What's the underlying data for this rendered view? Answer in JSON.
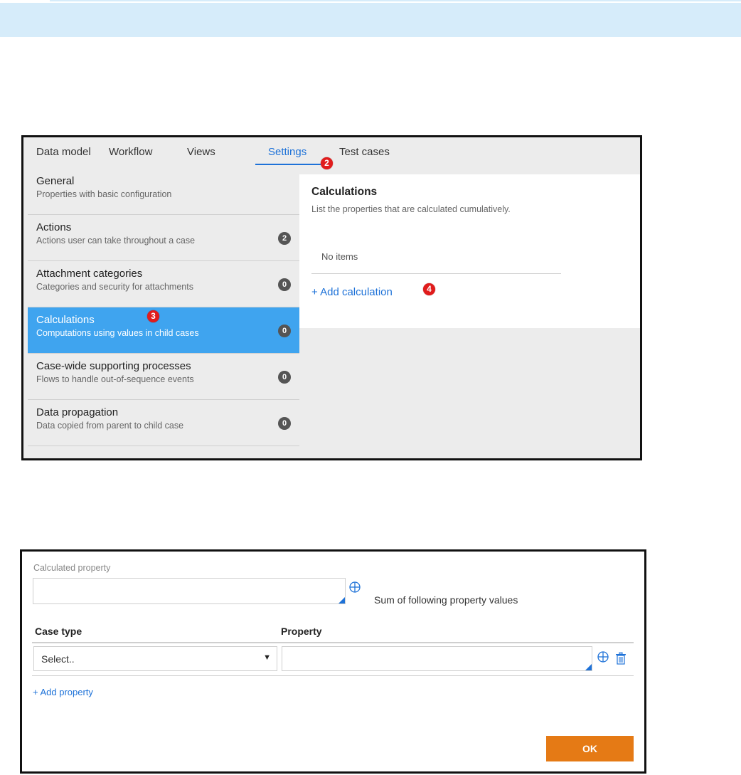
{
  "tabs": [
    {
      "label": "Data model"
    },
    {
      "label": "Workflow"
    },
    {
      "label": "Views"
    },
    {
      "label": "Settings"
    },
    {
      "label": "Test cases"
    }
  ],
  "active_tab": "Settings",
  "markers": [
    "2",
    "3",
    "4"
  ],
  "sidebar": {
    "items": [
      {
        "title": "General",
        "desc": "Properties with basic configuration"
      },
      {
        "title": "Actions",
        "desc": "Actions user can take throughout a case",
        "count": "2"
      },
      {
        "title": "Attachment categories",
        "desc": "Categories and security for attachments",
        "count": "0"
      },
      {
        "title": "Calculations",
        "desc": "Computations using values in child cases",
        "count": "0"
      },
      {
        "title": "Case-wide supporting processes",
        "desc": "Flows to handle out-of-sequence events",
        "count": "0"
      },
      {
        "title": "Data propagation",
        "desc": "Data copied from parent to child case",
        "count": "0"
      }
    ]
  },
  "content": {
    "title": "Calculations",
    "subtitle": "List the properties that are calculated cumulatively.",
    "empty_text": "No items",
    "add_link": "+ Add calculation"
  },
  "dialog": {
    "calculated_property_label": "Calculated property",
    "calculated_property_value": "",
    "sum_text": "Sum of following property values",
    "columns": [
      "Case type",
      "Property"
    ],
    "case_type_value": "Select..",
    "property_value": "",
    "add_property": "+ Add property",
    "ok_label": "OK"
  },
  "colors": {
    "accent_blue": "#1e72d8",
    "active_item": "#3fa4ef",
    "marker_red": "#e11c1c",
    "ok_orange": "#e57a15",
    "banner": "#d6ecfa"
  }
}
